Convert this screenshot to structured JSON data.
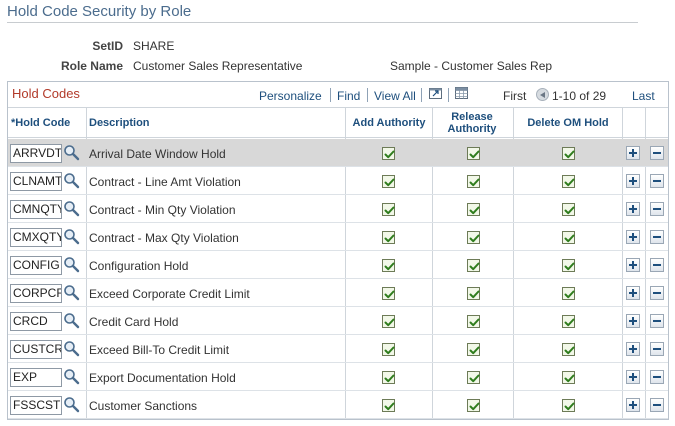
{
  "page": {
    "title": "Hold Code Security by Role"
  },
  "fields": {
    "setid_label": "SetID",
    "setid_value": "SHARE",
    "role_label": "Role Name",
    "role_value": "Customer Sales Representative",
    "role_desc": "Sample - Customer Sales Rep"
  },
  "grid": {
    "title": "Hold Codes",
    "nav": {
      "personalize": "Personalize",
      "find": "Find",
      "view_all": "View All",
      "first": "First",
      "range": "1-10 of 29",
      "last": "Last"
    },
    "columns": {
      "hold_code": "*Hold Code",
      "description": "Description",
      "add_authority": "Add Authority",
      "release_authority_1": "Release",
      "release_authority_2": "Authority",
      "delete_om_hold": "Delete OM Hold"
    },
    "rows": [
      {
        "code": "ARRVDT",
        "description": "Arrival Date Window Hold",
        "add": true,
        "release": true,
        "delete": true
      },
      {
        "code": "CLNAMT",
        "description": "Contract - Line Amt Violation",
        "add": true,
        "release": true,
        "delete": true
      },
      {
        "code": "CMNQTY",
        "description": "Contract - Min Qty Violation",
        "add": true,
        "release": true,
        "delete": true
      },
      {
        "code": "CMXQTY",
        "description": "Contract - Max Qty Violation",
        "add": true,
        "release": true,
        "delete": true
      },
      {
        "code": "CONFIG",
        "description": "Configuration Hold",
        "add": true,
        "release": true,
        "delete": true
      },
      {
        "code": "CORPCR",
        "description": "Exceed Corporate Credit Limit",
        "add": true,
        "release": true,
        "delete": true
      },
      {
        "code": "CRCD",
        "description": "Credit Card Hold",
        "add": true,
        "release": true,
        "delete": true
      },
      {
        "code": "CUSTCR",
        "description": "Exceed Bill-To Credit Limit",
        "add": true,
        "release": true,
        "delete": true
      },
      {
        "code": "EXP",
        "description": "Export Documentation Hold",
        "add": true,
        "release": true,
        "delete": true
      },
      {
        "code": "FSSCST",
        "description": "Customer Sanctions",
        "add": true,
        "release": true,
        "delete": true
      }
    ]
  },
  "icons": {
    "lookup": "magnifier-icon",
    "zoom": "zoom-window-icon",
    "download": "spreadsheet-icon",
    "prev": "previous-arrow-icon",
    "add_row": "plus-icon",
    "delete_row": "minus-icon"
  },
  "colors": {
    "title": "#4b6c8d",
    "grid_title": "#b23a2a",
    "link": "#1e4f7d",
    "selected_row": "#d8d8d8"
  }
}
